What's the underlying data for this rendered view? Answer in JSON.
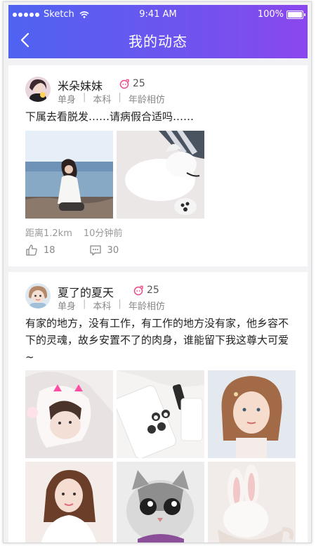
{
  "status_bar": {
    "carrier": "Sketch",
    "time": "9:41 AM",
    "battery": "100%"
  },
  "header": {
    "title": "我的动态"
  },
  "posts": [
    {
      "name": "米朵妹妹",
      "age": "25",
      "tags": [
        "单身",
        "本科",
        "年龄相仿"
      ],
      "text": "下属去看脱发……请病假合适吗……",
      "distance": "距离1.2km",
      "time": "10分钟前",
      "likes": "18",
      "comments": "30"
    },
    {
      "name": "夏了的夏天",
      "age": "25",
      "tags": [
        "单身",
        "本科",
        "年龄相仿"
      ],
      "text": "有家的地方，没有工作，有工作的地方没有家，他乡容不下的灵魂，故乡安置不了的肉身，谁能留下我这尊大可爱~"
    }
  ],
  "separator": "|",
  "colors": {
    "header_start": "#4f63f1",
    "header_end": "#8a47ee",
    "gender_female": "#e84a8a"
  }
}
